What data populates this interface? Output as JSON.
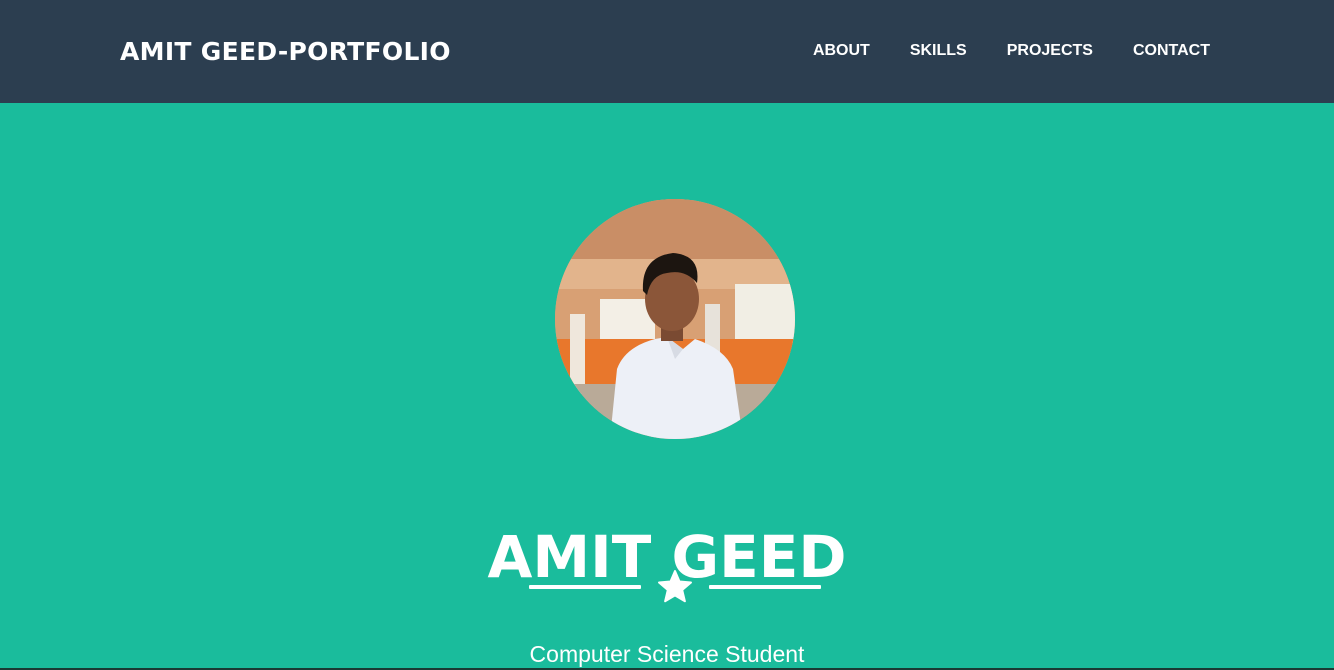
{
  "navbar": {
    "brand": "AMIT GEED-PORTFOLIO",
    "links": [
      {
        "label": "ABOUT"
      },
      {
        "label": "SKILLS"
      },
      {
        "label": "PROJECTS"
      },
      {
        "label": "CONTACT"
      }
    ]
  },
  "hero": {
    "name": "AMIT GEED",
    "subtitle": "Computer Science Student",
    "divider_icon": "star-icon",
    "avatar_alt": "profile-photo"
  },
  "colors": {
    "navbar_bg": "#2c3e50",
    "hero_bg": "#1abc9c",
    "text": "#ffffff"
  }
}
